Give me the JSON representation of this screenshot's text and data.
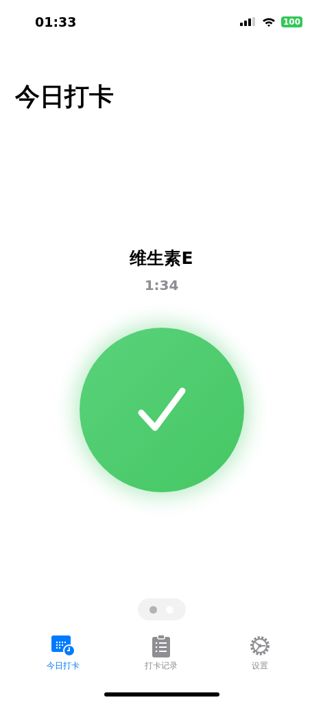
{
  "status_bar": {
    "time": "01:33",
    "battery": "100"
  },
  "title": "今日打卡",
  "checkin": {
    "name": "维生素E",
    "time": "1:34",
    "checked": true
  },
  "pages": [
    {
      "selected": true
    },
    {
      "selected": false
    }
  ],
  "tabs": [
    {
      "kind": "calendar",
      "label": "今日打卡",
      "selected": true
    },
    {
      "kind": "clipboard",
      "label": "打卡记录",
      "selected": false
    },
    {
      "kind": "gear",
      "label": "设置",
      "selected": false
    }
  ]
}
